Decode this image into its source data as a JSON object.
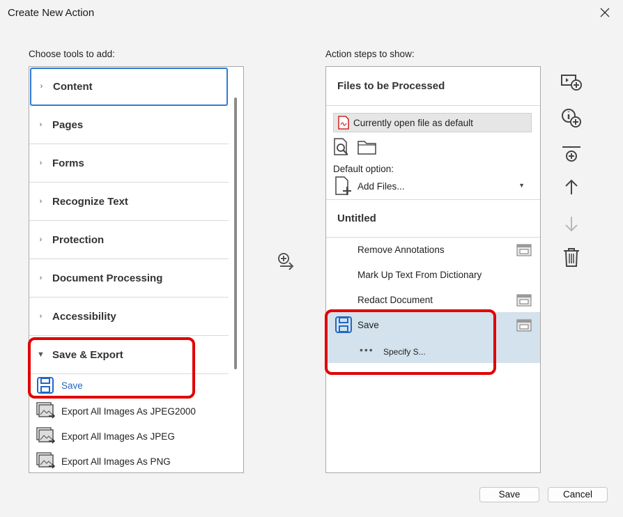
{
  "dialog": {
    "title": "Create New Action"
  },
  "left_panel": {
    "label": "Choose tools to add:",
    "categories": [
      "Content",
      "Pages",
      "Forms",
      "Recognize Text",
      "Protection",
      "Document Processing",
      "Accessibility"
    ],
    "expanded_category": "Save & Export",
    "expanded_items": [
      "Save",
      "Export All Images As JPEG2000",
      "Export All Images As JPEG",
      "Export All Images As PNG"
    ]
  },
  "right_panel": {
    "label": "Action steps to show:",
    "files_header": "Files to be Processed",
    "current_file": "Currently open file as default",
    "default_option_label": "Default option:",
    "default_option_value": "Add Files...",
    "untitled_header": "Untitled",
    "steps": [
      "Remove Annotations",
      "Mark Up Text From Dictionary",
      "Redact Document",
      "Save"
    ],
    "save_substep": "Specify S..."
  },
  "buttons": {
    "save": "Save",
    "cancel": "Cancel"
  },
  "colors": {
    "accent": "#2166c7",
    "highlight": "#e00000",
    "selected_bg": "#d3e2ec"
  }
}
